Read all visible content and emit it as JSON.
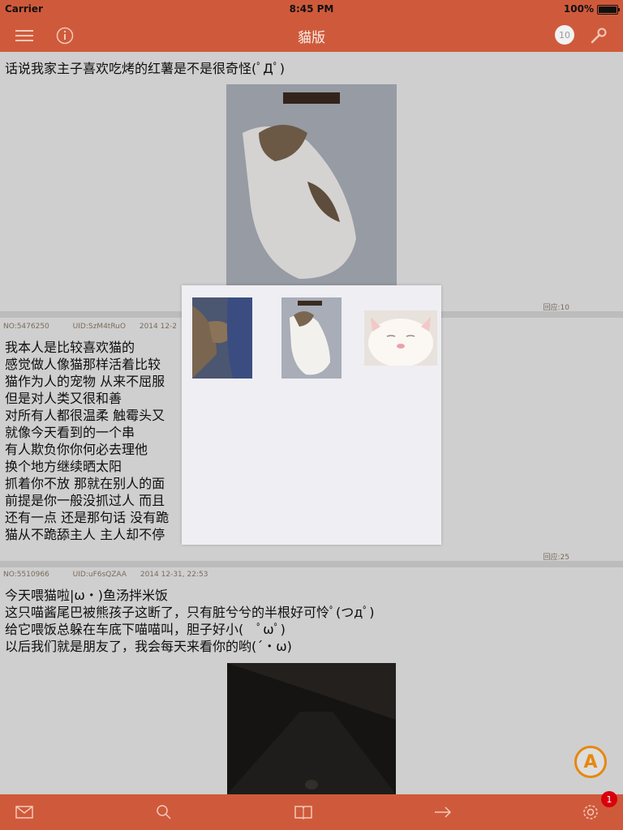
{
  "status_bar": {
    "carrier": "Carrier",
    "time": "8:45 PM",
    "battery": "100%"
  },
  "nav": {
    "title": "貓版",
    "count": "10",
    "menu_icon": "hamburger-icon",
    "info_icon": "info-icon",
    "settings_icon": "wrench-icon"
  },
  "posts": [
    {
      "text": "话说我家主子喜欢吃烤的红薯是不是很奇怪(ﾟДﾟ)",
      "replies": "回应:10"
    },
    {
      "no": "NO:5476250",
      "uid": "UID:SzM4tRuO",
      "date": "2014 12-2",
      "text": "我本人是比较喜欢猫的\n感觉做人像猫那样活着比较\n猫作为人的宠物 从来不屈服\n但是对人类又很和善\n对所有人都很温柔 触霉头又\n就像今天看到的一个串\n有人欺负你你何必去理他\n换个地方继续晒太阳\n抓着你不放 那就在别人的面\n前提是你一般没抓过人 而且\n还有一点 还是那句话 没有跪\n猫从不跪舔主人 主人却不停",
      "replies": "回应:25"
    },
    {
      "no": "NO:5510966",
      "uid": "UID:uF6sQZAA",
      "date": "2014 12-31, 22:53",
      "text": "今天喂猫啦|ω・)鱼汤拌米饭\n这只喵酱尾巴被熊孩子这断了，只有脏兮兮的半根好可怜ﾟ(つдﾟ)\n给它喂饭总躲在车底下喵喵叫，胆子好小(　ﾟωﾟ)\n以后我们就是朋友了，我会每天来看你的哟(´・ω)"
    }
  ],
  "tabbar": {
    "notification_count": "1",
    "icons": [
      "mail-icon",
      "search-icon",
      "book-icon",
      "arrow-right-icon",
      "gear-icon"
    ]
  },
  "fab_icon": "a-logo-icon",
  "colors": {
    "brand": "#cf5a3b",
    "badge": "#d9000b",
    "fab": "#e6880e"
  }
}
